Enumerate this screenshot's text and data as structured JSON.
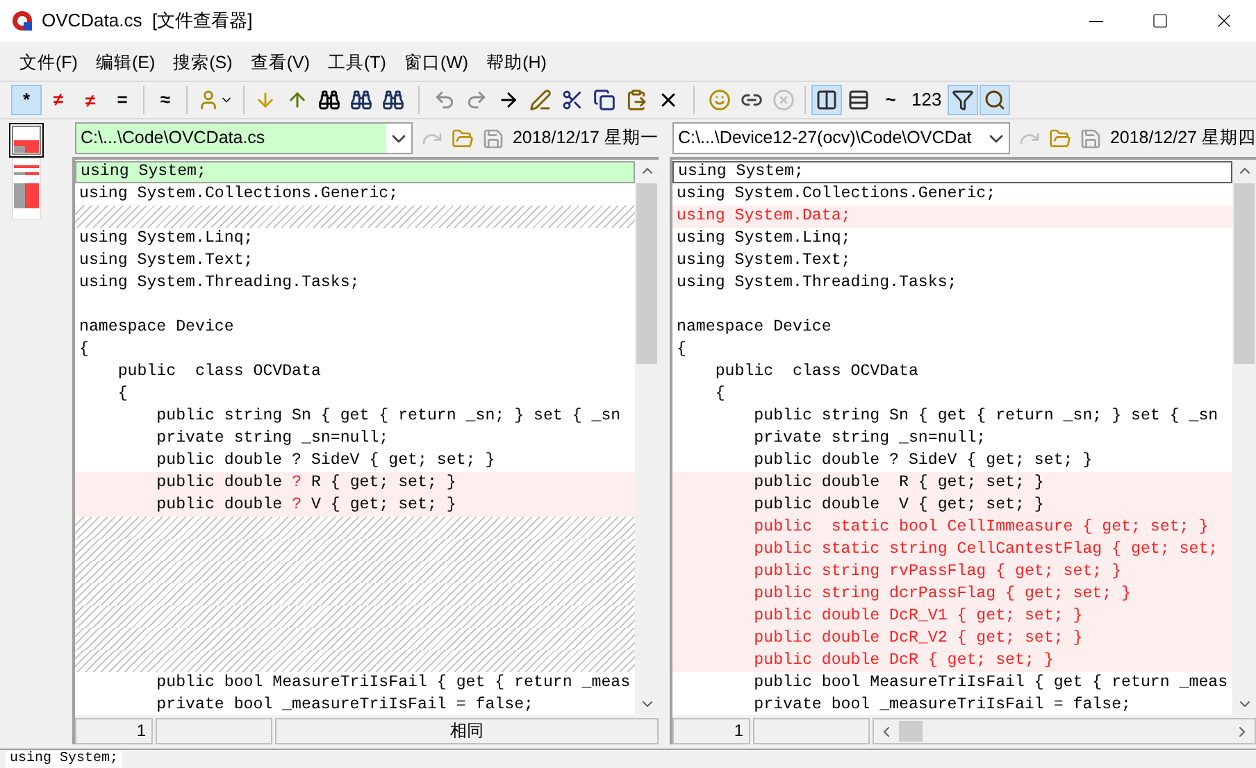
{
  "window": {
    "title": "OVCData.cs  [文件查看器]"
  },
  "menu": [
    "文件(F)",
    "编辑(E)",
    "搜索(S)",
    "查看(V)",
    "工具(T)",
    "窗口(W)",
    "帮助(H)"
  ],
  "toolbar": [
    {
      "label": "*",
      "pressed": true,
      "disabled": false
    },
    {
      "label": "≠",
      "pressed": false,
      "disabled": false
    },
    {
      "label": "≠",
      "pressed": false,
      "disabled": false
    },
    {
      "label": "=",
      "pressed": false,
      "disabled": false
    },
    {
      "label": "≈",
      "pressed": false,
      "disabled": false
    },
    {
      "pressed": false,
      "disabled": false
    },
    {
      "pressed": false,
      "disabled": false
    },
    {
      "pressed": false,
      "disabled": false
    },
    {
      "pressed": false,
      "disabled": false
    },
    {
      "pressed": false,
      "disabled": false
    },
    {
      "pressed": false,
      "disabled": false
    },
    {
      "pressed": false,
      "disabled": true
    },
    {
      "pressed": false,
      "disabled": true
    },
    {
      "pressed": false,
      "disabled": false
    },
    {
      "pressed": false,
      "disabled": false
    },
    {
      "pressed": false,
      "disabled": false
    },
    {
      "pressed": false,
      "disabled": false
    },
    {
      "pressed": false,
      "disabled": false
    },
    {
      "pressed": false,
      "disabled": false
    },
    {
      "pressed": false,
      "disabled": false
    },
    {
      "pressed": false,
      "disabled": false
    },
    {
      "pressed": false,
      "disabled": true
    },
    {
      "pressed": true,
      "disabled": false
    },
    {
      "pressed": false,
      "disabled": false
    },
    {
      "label": "~",
      "pressed": false,
      "disabled": false
    },
    {
      "label": "123",
      "pressed": false,
      "disabled": false
    },
    {
      "pressed": true,
      "disabled": false
    },
    {
      "pressed": true,
      "disabled": false
    }
  ],
  "panes": [
    {
      "path": "C:\\...\\Code\\OVCData.cs",
      "date": "2018/12/17 星期一",
      "focused": true,
      "lines": [
        {
          "kind": "current",
          "text": "using System;"
        },
        {
          "kind": "same",
          "text": "using System.Collections.Generic;"
        },
        {
          "kind": "gap"
        },
        {
          "kind": "same",
          "text": "using System.Linq;"
        },
        {
          "kind": "same",
          "text": "using System.Text;"
        },
        {
          "kind": "same",
          "text": "using System.Threading.Tasks;"
        },
        {
          "kind": "blank"
        },
        {
          "kind": "same",
          "text": "namespace Device"
        },
        {
          "kind": "same",
          "text": "{"
        },
        {
          "kind": "same",
          "text": "    public  class OCVData"
        },
        {
          "kind": "same",
          "text": "    {"
        },
        {
          "kind": "same",
          "text": "        public string Sn { get { return _sn; } set { _sn"
        },
        {
          "kind": "same",
          "text": "        private string _sn=null;"
        },
        {
          "kind": "same",
          "text": "        public double ? SideV { get; set; }"
        },
        {
          "kind": "changed",
          "parts": [
            {
              "text": "        public double ",
              "diff": false
            },
            {
              "text": "?",
              "diff": true
            },
            {
              "text": " R { get; set; }",
              "diff": false
            }
          ]
        },
        {
          "kind": "changed",
          "parts": [
            {
              "text": "        public double ",
              "diff": false
            },
            {
              "text": "?",
              "diff": true
            },
            {
              "text": " V { get; set; }",
              "diff": false
            }
          ]
        },
        {
          "kind": "gap"
        },
        {
          "kind": "gap"
        },
        {
          "kind": "gap"
        },
        {
          "kind": "gap"
        },
        {
          "kind": "gap"
        },
        {
          "kind": "gap"
        },
        {
          "kind": "gap"
        },
        {
          "kind": "same",
          "text": "        public bool MeasureTriIsFail { get { return _meas"
        },
        {
          "kind": "same",
          "text": "        private bool _measureTriIsFail = false;"
        }
      ],
      "status": {
        "line": "1",
        "compare": "相同"
      }
    },
    {
      "path": "C:\\...\\Device12-27(ocv)\\Code\\OVCDat",
      "date": "2018/12/27 星期四",
      "focused": false,
      "lines": [
        {
          "kind": "current",
          "text": "using System;"
        },
        {
          "kind": "same",
          "text": "using System.Collections.Generic;"
        },
        {
          "kind": "added",
          "text": "using System.Data;"
        },
        {
          "kind": "same",
          "text": "using System.Linq;"
        },
        {
          "kind": "same",
          "text": "using System.Text;"
        },
        {
          "kind": "same",
          "text": "using System.Threading.Tasks;"
        },
        {
          "kind": "blank"
        },
        {
          "kind": "same",
          "text": "namespace Device"
        },
        {
          "kind": "same",
          "text": "{"
        },
        {
          "kind": "same",
          "text": "    public  class OCVData"
        },
        {
          "kind": "same",
          "text": "    {"
        },
        {
          "kind": "same",
          "text": "        public string Sn { get { return _sn; } set { _sn"
        },
        {
          "kind": "same",
          "text": "        private string _sn=null;"
        },
        {
          "kind": "same",
          "text": "        public double ? SideV { get; set; }"
        },
        {
          "kind": "changed",
          "text": "        public double  R { get; set; }"
        },
        {
          "kind": "changed",
          "text": "        public double  V { get; set; }"
        },
        {
          "kind": "added",
          "text": "        public  static bool CellImmeasure { get; set; }"
        },
        {
          "kind": "added",
          "text": "        public static string CellCantestFlag { get; set;"
        },
        {
          "kind": "added",
          "text": "        public string rvPassFlag { get; set; }"
        },
        {
          "kind": "added",
          "text": "        public string dcrPassFlag { get; set; }"
        },
        {
          "kind": "added",
          "text": "        public double DcR_V1 { get; set; }"
        },
        {
          "kind": "added",
          "text": "        public double DcR_V2 { get; set; }"
        },
        {
          "kind": "added",
          "text": "        public double DcR { get; set; }"
        },
        {
          "kind": "same",
          "text": "        public bool MeasureTriIsFail { get { return _meas"
        },
        {
          "kind": "same",
          "text": "        private bool _measureTriIsFail = false;"
        }
      ],
      "status": {
        "line": "1"
      }
    }
  ],
  "bottom_line": "using System;"
}
